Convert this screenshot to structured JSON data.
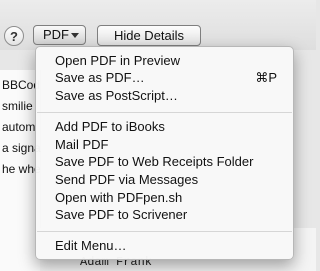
{
  "toolbar": {
    "help_label": "?",
    "pdf_label": "PDF",
    "hide_details_label": "Hide Details"
  },
  "background": {
    "left_lines": [
      "BBCod",
      "smilie",
      "autom",
      "a signa",
      "he whe"
    ],
    "bottom_name": "Adam Frank"
  },
  "menu": {
    "group1": [
      {
        "label": "Open PDF in Preview"
      },
      {
        "label": "Save as PDF…",
        "shortcut": "⌘P"
      },
      {
        "label": "Save as PostScript…"
      }
    ],
    "group2": [
      {
        "label": "Add PDF to iBooks"
      },
      {
        "label": "Mail PDF"
      },
      {
        "label": "Save PDF to Web Receipts Folder"
      },
      {
        "label": "Send PDF via Messages"
      },
      {
        "label": "Open with PDFpen.sh"
      },
      {
        "label": "Save PDF to Scrivener"
      }
    ],
    "group3": [
      {
        "label": "Edit Menu…"
      }
    ]
  }
}
